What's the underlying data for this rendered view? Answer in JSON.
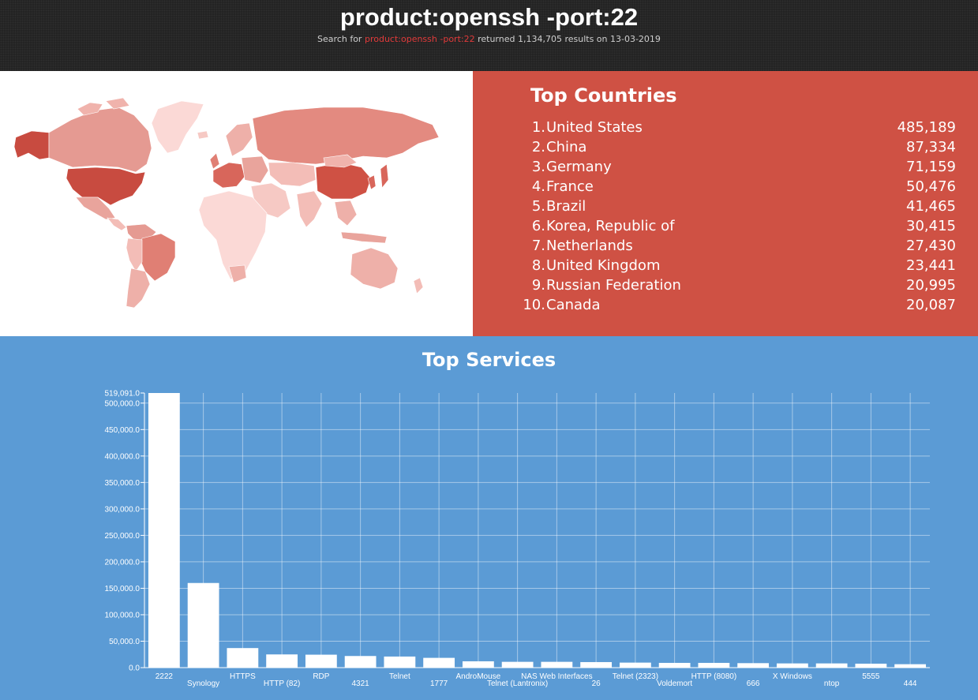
{
  "header": {
    "title": "product:openssh -port:22",
    "subtitle_prefix": "Search for ",
    "subtitle_query": "product:openssh -port:22",
    "subtitle_suffix": " returned 1,134,705 results on 13-03-2019"
  },
  "countries": {
    "title": "Top Countries",
    "items": [
      {
        "rank": "1.",
        "name": "United States",
        "value": "485,189"
      },
      {
        "rank": "2.",
        "name": "China",
        "value": "87,334"
      },
      {
        "rank": "3.",
        "name": "Germany",
        "value": "71,159"
      },
      {
        "rank": "4.",
        "name": "France",
        "value": "50,476"
      },
      {
        "rank": "5.",
        "name": "Brazil",
        "value": "41,465"
      },
      {
        "rank": "6.",
        "name": "Korea, Republic of",
        "value": "30,415"
      },
      {
        "rank": "7.",
        "name": "Netherlands",
        "value": "27,430"
      },
      {
        "rank": "8.",
        "name": "United Kingdom",
        "value": "23,441"
      },
      {
        "rank": "9.",
        "name": "Russian Federation",
        "value": "20,995"
      },
      {
        "rank": "10.",
        "name": "Canada",
        "value": "20,087"
      }
    ]
  },
  "colors": {
    "header_bg": "#232323",
    "query_red": "#e03a3a",
    "countries_bg": "#cf5144",
    "services_bg": "#5b9bd5",
    "map_dark": "#c84b40",
    "map_mid": "#e38a80",
    "map_light": "#f6c9c4"
  },
  "services": {
    "title": "Top Services"
  },
  "chart_data": {
    "type": "bar",
    "title": "Top Services",
    "categories": [
      "2222",
      "Synology",
      "HTTPS",
      "HTTP (82)",
      "RDP",
      "4321",
      "Telnet",
      "1777",
      "AndroMouse",
      "Telnet (Lantronix)",
      "NAS Web Interfaces",
      "26",
      "Telnet (2323)",
      "Voldemort",
      "HTTP (8080)",
      "666",
      "X Windows",
      "ntop",
      "5555",
      "444"
    ],
    "values": [
      519091,
      160000,
      37000,
      25000,
      24500,
      22000,
      21000,
      18500,
      12000,
      11000,
      11000,
      10500,
      9500,
      9000,
      9000,
      8500,
      8000,
      8000,
      7500,
      6500
    ],
    "ylim": [
      0,
      519091
    ],
    "yticks": [
      "0.0",
      "50,000.0",
      "100,000.0",
      "150,000.0",
      "200,000.0",
      "250,000.0",
      "300,000.0",
      "350,000.0",
      "400,000.0",
      "450,000.0",
      "500,000.0"
    ],
    "ytick_values": [
      0,
      50000,
      100000,
      150000,
      200000,
      250000,
      300000,
      350000,
      400000,
      450000,
      500000
    ],
    "ymax_label": "519,091.0",
    "grid": true,
    "bar_color": "#ffffff"
  }
}
